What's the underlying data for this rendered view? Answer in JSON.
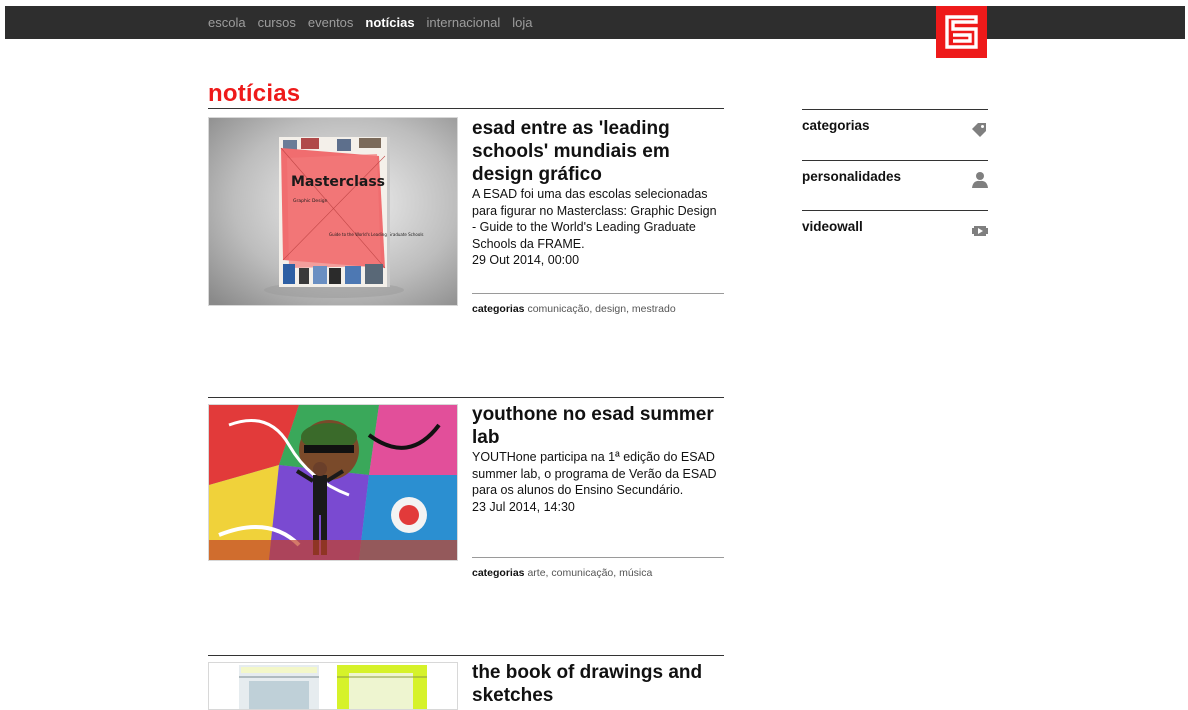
{
  "nav": {
    "items": [
      {
        "label": "escola",
        "active": false
      },
      {
        "label": "cursos",
        "active": false
      },
      {
        "label": "eventos",
        "active": false
      },
      {
        "label": "notícias",
        "active": true
      },
      {
        "label": "internacional",
        "active": false
      },
      {
        "label": "loja",
        "active": false
      }
    ]
  },
  "page": {
    "title": "notícias"
  },
  "articles": [
    {
      "title": "esad entre as 'leading schools' mundiais em design gráfico",
      "summary": "A ESAD foi uma das escolas selecionadas para figurar no Masterclass: Graphic Design - Guide to the World's Leading Graduate Schools da FRAME.",
      "date": "29 Out 2014, 00:00",
      "categories_label": "categorias",
      "categories": "comunicação, design, mestrado",
      "image_text": {
        "title": "Masterclass",
        "sub": "Graphic Design",
        "guide": "Guide to the World's Leading Graduate Schools"
      }
    },
    {
      "title": "youthone no esad summer lab",
      "summary": "YOUTHone participa na 1ª edição do ESAD summer lab, o programa de Verão da ESAD para os alunos do Ensino Secundário.",
      "date": "23 Jul 2014, 14:30",
      "categories_label": "categorias",
      "categories": "arte, comunicação, música"
    },
    {
      "title": "the book of drawings and sketches"
    }
  ],
  "sidebar": {
    "items": [
      {
        "label": "categorias",
        "icon": "tag-icon"
      },
      {
        "label": "personalidades",
        "icon": "person-icon"
      },
      {
        "label": "videowall",
        "icon": "video-icon"
      }
    ]
  },
  "colors": {
    "accent": "#ee1a1a",
    "topbar": "#2e2e2e"
  }
}
